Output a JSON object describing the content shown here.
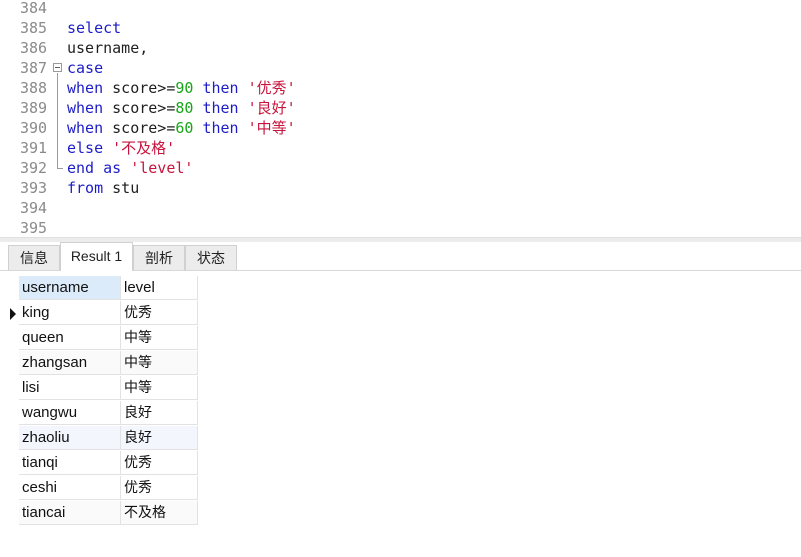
{
  "editor": {
    "lines": [
      {
        "num": "384",
        "tokens": []
      },
      {
        "num": "385",
        "tokens": [
          {
            "t": "kw",
            "v": "select"
          }
        ]
      },
      {
        "num": "386",
        "tokens": [
          {
            "t": "plain",
            "v": "username,"
          }
        ]
      },
      {
        "num": "387",
        "tokens": [
          {
            "t": "kw",
            "v": "case"
          }
        ]
      },
      {
        "num": "388",
        "tokens": [
          {
            "t": "kw",
            "v": "when"
          },
          {
            "t": "plain",
            "v": " score>="
          },
          {
            "t": "num",
            "v": "90"
          },
          {
            "t": "plain",
            "v": " "
          },
          {
            "t": "kw",
            "v": "then"
          },
          {
            "t": "plain",
            "v": " "
          },
          {
            "t": "str",
            "v": "'优秀'"
          }
        ]
      },
      {
        "num": "389",
        "tokens": [
          {
            "t": "kw",
            "v": "when"
          },
          {
            "t": "plain",
            "v": " score>="
          },
          {
            "t": "num",
            "v": "80"
          },
          {
            "t": "plain",
            "v": " "
          },
          {
            "t": "kw",
            "v": "then"
          },
          {
            "t": "plain",
            "v": " "
          },
          {
            "t": "str",
            "v": "'良好'"
          }
        ]
      },
      {
        "num": "390",
        "tokens": [
          {
            "t": "kw",
            "v": "when"
          },
          {
            "t": "plain",
            "v": " score>="
          },
          {
            "t": "num",
            "v": "60"
          },
          {
            "t": "plain",
            "v": " "
          },
          {
            "t": "kw",
            "v": "then"
          },
          {
            "t": "plain",
            "v": " "
          },
          {
            "t": "str",
            "v": "'中等'"
          }
        ]
      },
      {
        "num": "391",
        "tokens": [
          {
            "t": "kw",
            "v": "else"
          },
          {
            "t": "plain",
            "v": " "
          },
          {
            "t": "str",
            "v": "'不及格'"
          }
        ]
      },
      {
        "num": "392",
        "tokens": [
          {
            "t": "kw",
            "v": "end"
          },
          {
            "t": "plain",
            "v": " "
          },
          {
            "t": "kw",
            "v": "as"
          },
          {
            "t": "plain",
            "v": " "
          },
          {
            "t": "str",
            "v": "'level'"
          }
        ]
      },
      {
        "num": "393",
        "tokens": [
          {
            "t": "kw",
            "v": "from"
          },
          {
            "t": "plain",
            "v": " stu"
          }
        ]
      },
      {
        "num": "394",
        "tokens": []
      },
      {
        "num": "395",
        "tokens": []
      }
    ]
  },
  "tabs": [
    {
      "label": "信息",
      "active": false
    },
    {
      "label": "Result 1",
      "active": true
    },
    {
      "label": "剖析",
      "active": false
    },
    {
      "label": "状态",
      "active": false
    }
  ],
  "result": {
    "columns": [
      "username",
      "level"
    ],
    "rows": [
      [
        "king",
        "优秀"
      ],
      [
        "queen",
        "中等"
      ],
      [
        "zhangsan",
        "中等"
      ],
      [
        "lisi",
        "中等"
      ],
      [
        "wangwu",
        "良好"
      ],
      [
        "zhaoliu",
        "良好"
      ],
      [
        "tianqi",
        "优秀"
      ],
      [
        "ceshi",
        "优秀"
      ],
      [
        "tiancai",
        "不及格"
      ]
    ],
    "current_row_index": 0
  },
  "colors": {
    "keyword": "#1d1dc8",
    "number": "#19a519",
    "string": "#c8143c",
    "line_number": "#8a8a8a",
    "header_selected": "#dcebfa"
  }
}
